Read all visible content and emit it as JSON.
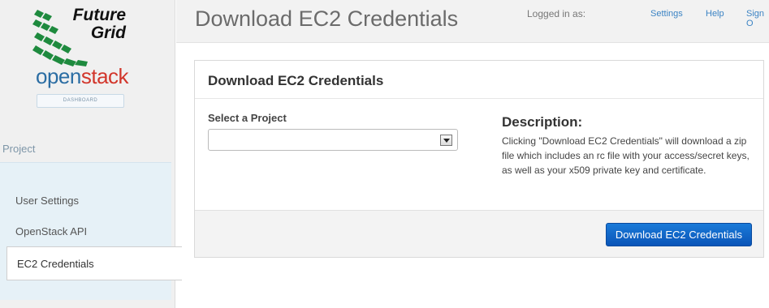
{
  "brand": {
    "futuregrid_line1": "Future",
    "futuregrid_line2": "Grid",
    "openstack_open": "open",
    "openstack_stack": "stack",
    "dashboard_badge": "DASHBOARD"
  },
  "sidebar": {
    "section_label": "Project",
    "items": [
      {
        "label": "User Settings",
        "active": false
      },
      {
        "label": "OpenStack API",
        "active": false
      },
      {
        "label": "EC2 Credentials",
        "active": true
      }
    ]
  },
  "header": {
    "title": "Download EC2 Credentials",
    "logged_in_label": "Logged in as:",
    "links": [
      "Settings",
      "Help",
      "Sign O"
    ]
  },
  "panel": {
    "title": "Download EC2 Credentials",
    "project_label": "Select a Project",
    "project_value": "",
    "description_title": "Description:",
    "description_text": "Clicking \"Download EC2 Credentials\" will download a zip file which includes an rc file with your access/secret keys, as well as your x509 private key and certificate.",
    "submit_label": "Download EC2 Credentials"
  },
  "colors": {
    "primary_button": "#0a62c6",
    "link": "#3c84c4",
    "openstack_blue": "#2b6da3",
    "openstack_red": "#d2362b",
    "futuregrid_green": "#1e8a3e"
  }
}
